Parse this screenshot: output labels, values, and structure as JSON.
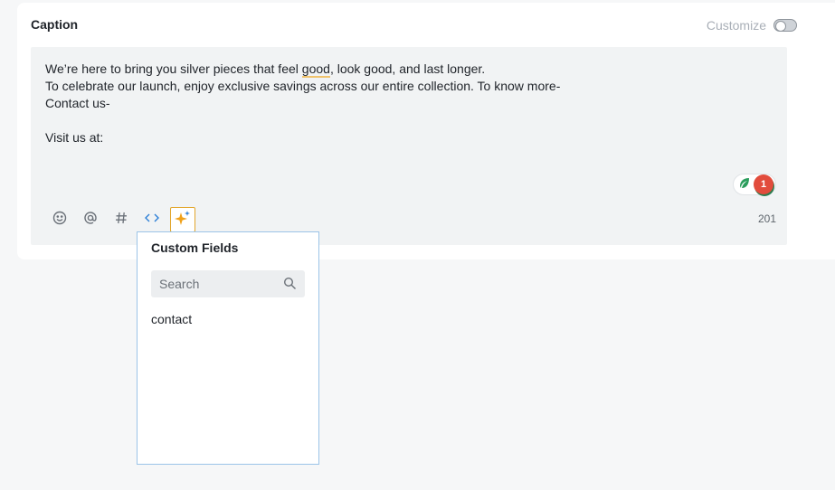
{
  "caption": {
    "title": "Caption",
    "customize_label": "Customize",
    "customize_enabled": false
  },
  "editor": {
    "lines": [
      {
        "pre": "We’re here to bring you silver pieces that feel ",
        "flagged": "good",
        "post": ", look good, and last longer."
      },
      {
        "text": "To celebrate our launch, enjoy exclusive savings across our entire collection. To know more-"
      },
      {
        "text": "Contact us-"
      },
      {
        "text": ""
      },
      {
        "text": "Visit us at:"
      }
    ],
    "grammar_issue_count": "1",
    "char_count": "201",
    "toolbar": [
      {
        "name": "emoji-icon"
      },
      {
        "name": "mention-icon"
      },
      {
        "name": "hashtag-icon"
      },
      {
        "name": "code-icon"
      },
      {
        "name": "ai-sparkle-icon"
      }
    ]
  },
  "custom_fields": {
    "title": "Custom Fields",
    "search_placeholder": "Search",
    "items": [
      "contact"
    ]
  },
  "colors": {
    "accent_blue": "#2d7fd6",
    "sparkle": "#f0a11a",
    "badge_red": "#e24c3c",
    "leaf_green": "#2a9d5c"
  }
}
